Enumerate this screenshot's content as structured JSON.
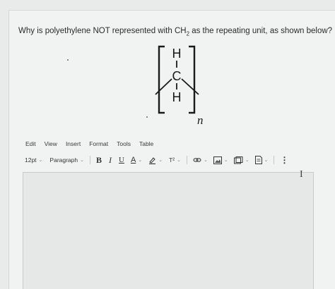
{
  "question": {
    "prefix": "Why is polyethylene NOT represented with CH",
    "subscript": "2",
    "suffix": " as the repeating unit, as shown below?"
  },
  "structure": {
    "top_atom": "H",
    "center_atom": "C",
    "bottom_atom": "H",
    "repeat_label": "n"
  },
  "menu": [
    "Edit",
    "View",
    "Insert",
    "Format",
    "Tools",
    "Table"
  ],
  "toolbar": {
    "font_size": "12pt",
    "block_format": "Paragraph",
    "bold": "B",
    "italic": "I",
    "underline": "U",
    "font_color": "A",
    "superscript": "T²",
    "more": "⋮"
  },
  "cursor": "I"
}
